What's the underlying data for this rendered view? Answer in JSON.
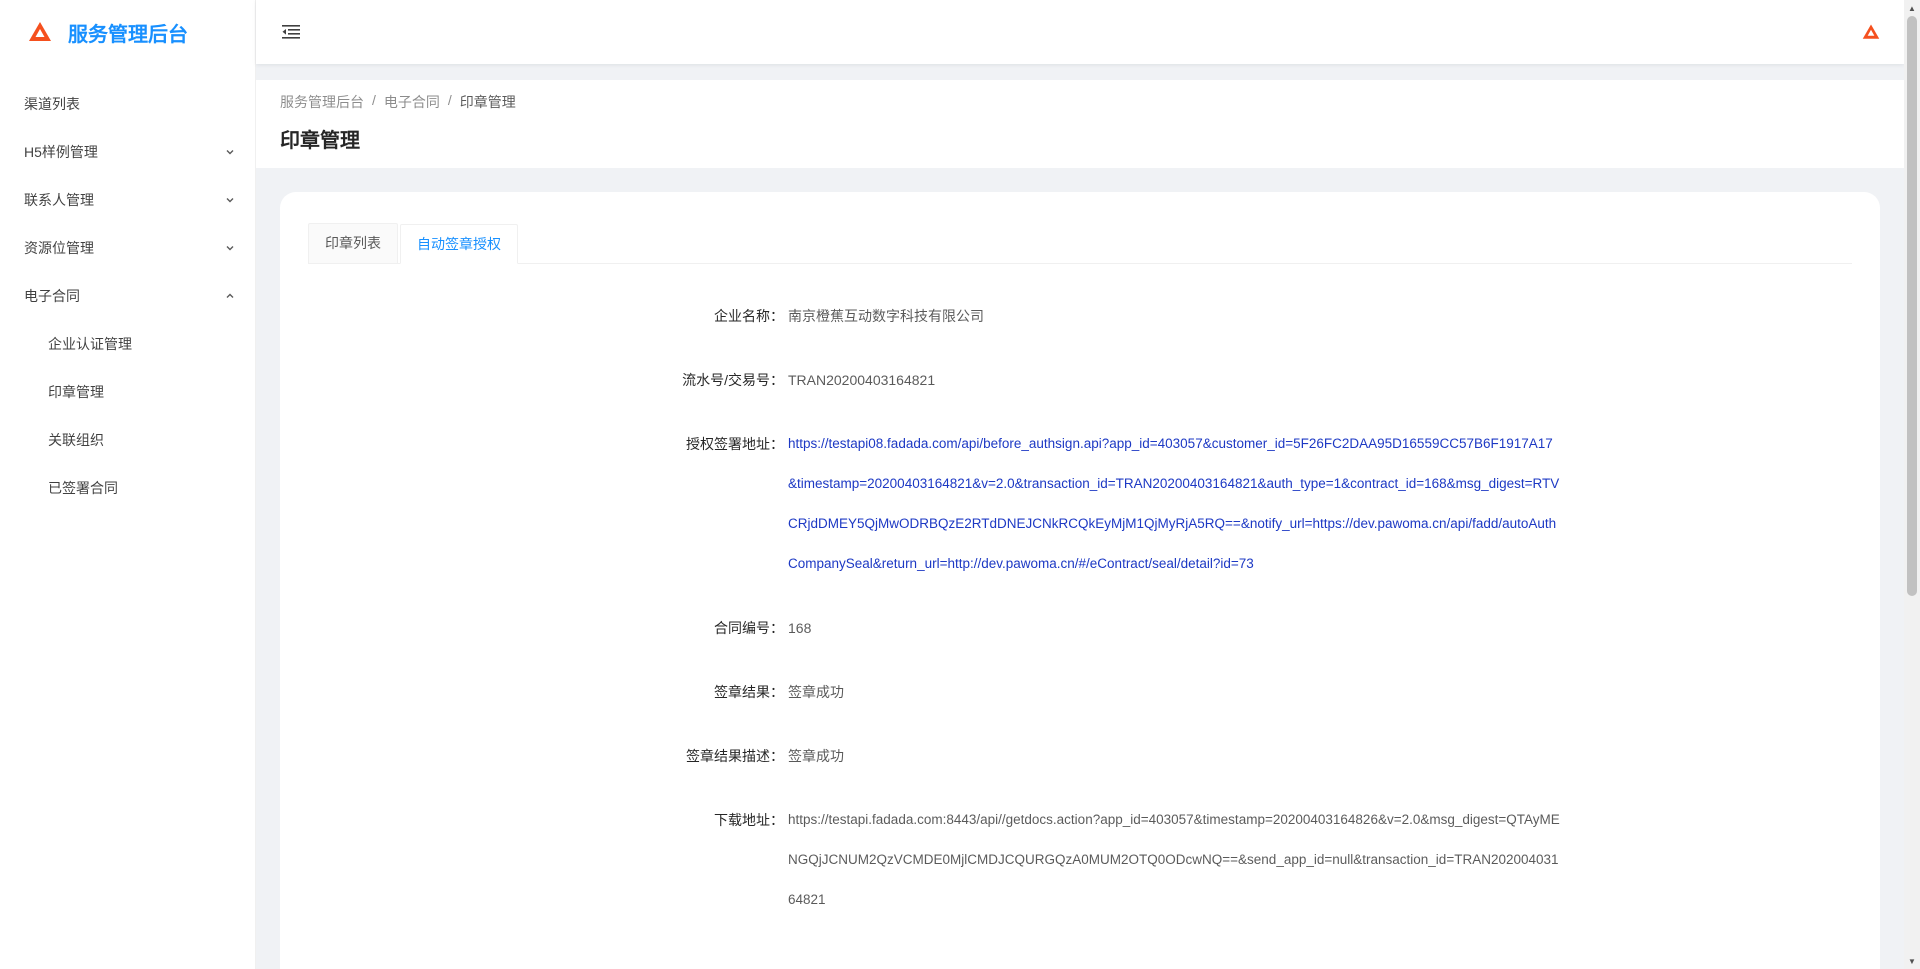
{
  "app": {
    "title": "服务管理后台"
  },
  "sidebar": {
    "items": [
      {
        "label": "渠道列表"
      },
      {
        "label": "H5样例管理"
      },
      {
        "label": "联系人管理"
      },
      {
        "label": "资源位管理"
      },
      {
        "label": "电子合同"
      }
    ],
    "subitems": [
      {
        "label": "企业认证管理"
      },
      {
        "label": "印章管理"
      },
      {
        "label": "关联组织"
      },
      {
        "label": "已签署合同"
      }
    ]
  },
  "breadcrumb": {
    "root": "服务管理后台",
    "parent": "电子合同",
    "current": "印章管理",
    "sep": "/"
  },
  "page": {
    "title": "印章管理"
  },
  "tabs": [
    {
      "label": "印章列表"
    },
    {
      "label": "自动签章授权"
    }
  ],
  "details": [
    {
      "label": "企业名称：",
      "value": "南京橙蕉互动数字科技有限公司"
    },
    {
      "label": "流水号/交易号：",
      "value": "TRAN20200403164821"
    },
    {
      "label": "授权签署地址：",
      "value": "https://testapi08.fadada.com/api/before_authsign.api?app_id=403057&customer_id=5F26FC2DAA95D16559CC57B6F1917A17&timestamp=20200403164821&v=2.0&transaction_id=TRAN20200403164821&auth_type=1&contract_id=168&msg_digest=RTVCRjdDMEY5QjMwODRBQzE2RTdDNEJCNkRCQkEyMjM1QjMyRjA5RQ==&notify_url=https://dev.pawoma.cn/api/fadd/autoAuthCompanySeal&return_url=http://dev.pawoma.cn/#/eContract/seal/detail?id=73"
    },
    {
      "label": "合同编号：",
      "value": "168"
    },
    {
      "label": "签章结果：",
      "value": "签章成功"
    },
    {
      "label": "签章结果描述：",
      "value": "签章成功"
    },
    {
      "label": "下载地址：",
      "value": "https://testapi.fadada.com:8443/api//getdocs.action?app_id=403057&timestamp=20200403164826&v=2.0&msg_digest=QTAyMENGQjJCNUM2QzVCMDE0MjlCMDJCQURGQzA0MUM2OTQ0ODcwNQ==&send_app_id=null&transaction_id=TRAN20200403164821"
    }
  ],
  "colors": {
    "primary": "#1890ff",
    "link": "#1d39c4",
    "logo": "#f5501e"
  }
}
